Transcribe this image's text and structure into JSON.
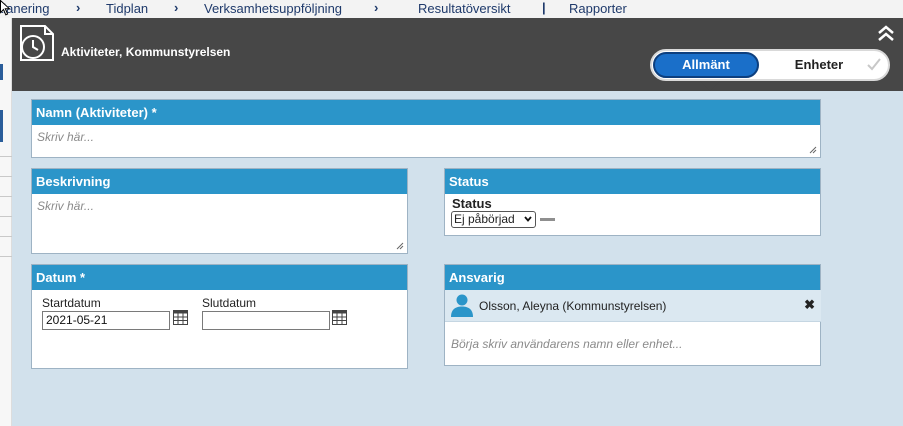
{
  "background_nav": {
    "items": [
      "alanering",
      "Tidplan",
      "Verksamhetsuppföljning",
      "Resultatöversikt",
      "Rapporter"
    ]
  },
  "modal": {
    "title": "Aktiviteter, Kommunstyrelsen",
    "header_icon": "clock-document-icon",
    "tabs": [
      {
        "label": "Allmänt",
        "active": true
      },
      {
        "label": "Enheter",
        "active": false
      }
    ]
  },
  "name_panel": {
    "heading": "Namn (Aktiviteter) *",
    "placeholder": "Skriv här..."
  },
  "description_panel": {
    "heading": "Beskrivning",
    "placeholder": "Skriv här..."
  },
  "status_panel": {
    "heading": "Status",
    "label": "Status",
    "selected": "Ej påbörjad"
  },
  "date_panel": {
    "heading": "Datum *",
    "start_label": "Startdatum",
    "start_value": "2021-05-21",
    "end_label": "Slutdatum",
    "end_value": ""
  },
  "responsible_panel": {
    "heading": "Ansvarig",
    "person": "Olsson, Aleyna (Kommunstyrelsen)",
    "remove_symbol": "✖",
    "search_placeholder": "Börja skriv användarens namn eller enhet..."
  },
  "colors": {
    "header_bg": "#474747",
    "panel_head": "#2b95c9",
    "modal_bg": "#d2e1ec",
    "toggle_active": "#1a6fc9"
  }
}
